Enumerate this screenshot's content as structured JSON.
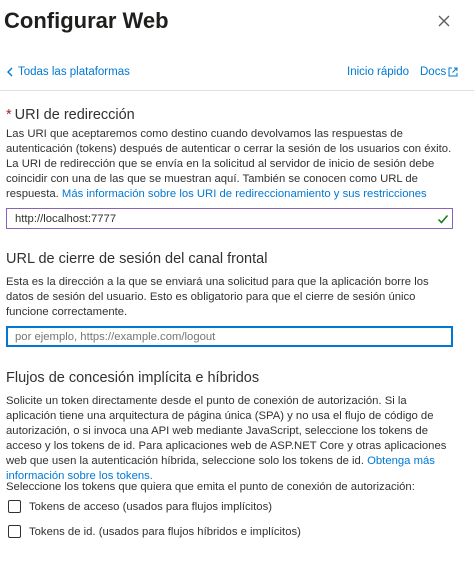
{
  "header": {
    "title": "Configurar Web",
    "close_label": "close"
  },
  "nav": {
    "back_label": "Todas las plataformas",
    "quick_start_label": "Inicio rápido",
    "docs_label": "Docs"
  },
  "redirect": {
    "required_marker": "*",
    "title": "URI de redirección",
    "description": "Las URI que aceptaremos como destino cuando devolvamos las respuestas de autenticación (tokens) después de autenticar o cerrar la sesión de los usuarios con éxito. La URI de redirección que se envía en la solicitud al servidor de inicio de sesión debe coincidir con una de las que se muestran aquí. También se conocen como URL de respuesta.",
    "link": "Más información sobre los URI de redireccionamiento y sus restricciones",
    "value": "http://localhost:7777"
  },
  "logout": {
    "title": "URL de cierre de sesión del canal frontal",
    "description": "Esta es la dirección a la que se enviará una solicitud para que la aplicación borre los datos de sesión del usuario. Esto es obligatorio para que el cierre de sesión único funcione correctamente.",
    "value": "",
    "placeholder": "por ejemplo, https://example.com/logout"
  },
  "implicit": {
    "title": "Flujos de concesión implícita e híbridos",
    "description": "Solicite un token directamente desde el punto de conexión de autorización. Si la aplicación tiene una arquitectura de página única (SPA) y no usa el flujo de código de autorización, o si invoca una API web mediante JavaScript, seleccione los tokens de acceso y los tokens de id. Para aplicaciones web de ASP.NET Core y otras aplicaciones web que usen la autenticación híbrida, seleccione solo los tokens de id.",
    "link": "Obtenga más información sobre los tokens.",
    "select_prompt": "Seleccione los tokens que quiera que emita el punto de conexión de autorización:",
    "options": [
      {
        "label": "Tokens de acceso (usados para flujos implícitos)",
        "checked": false
      },
      {
        "label": "Tokens de id. (usados para flujos híbridos e implícitos)",
        "checked": false
      }
    ]
  }
}
